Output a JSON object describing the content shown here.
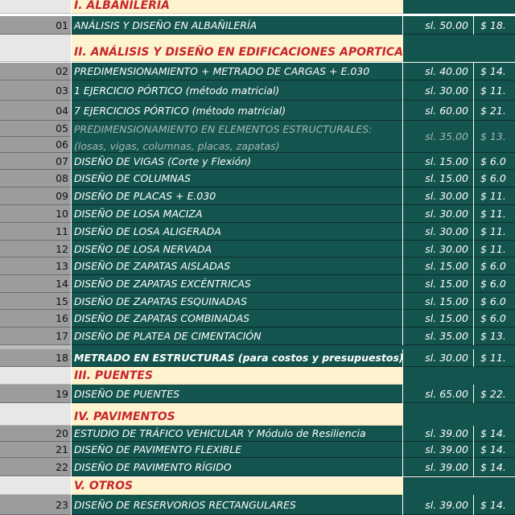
{
  "sections": {
    "s1": "I. ALBAÑILERIA",
    "s2": "II. ANÁLISIS Y DISEÑO EN EDIFICACIONES APORTICADAS",
    "s3": "III. PUENTES",
    "s4": "IV. PAVIMENTOS",
    "s5": "V. OTROS"
  },
  "rows": [
    {
      "num": "01",
      "desc": "ANÁLISIS Y DISEÑO EN ALBAÑILERÍA",
      "price_sl": "sl. 50.00",
      "price_usd": "$ 18."
    },
    {
      "num": "02",
      "desc": "PREDIMENSIONAMIENTO + METRADO DE CARGAS + E.030",
      "price_sl": "sl. 40.00",
      "price_usd": "$ 14."
    },
    {
      "num": "03",
      "desc": "1 EJERCICIO PÓRTICO (método matricial)",
      "price_sl": "sl. 30.00",
      "price_usd": "$ 11."
    },
    {
      "num": "04",
      "desc": "7 EJERCICIOS PÓRTICO (método matricial)",
      "price_sl": "sl. 60.00",
      "price_usd": "$ 21."
    },
    {
      "num": "05",
      "num_b": "06",
      "desc": "PREDIMENSIONAMIENTO EN ELEMENTOS ESTRUCTURALES:",
      "desc_b": "(losas, vigas, columnas, placas, zapatas)",
      "price_sl": "sl. 35.00",
      "price_usd": "$ 13."
    },
    {
      "num": "07",
      "desc": "DISEÑO DE VIGAS (Corte y Flexión)",
      "price_sl": "sl. 15.00",
      "price_usd": "$ 6.0"
    },
    {
      "num": "08",
      "desc": "DISEÑO DE COLUMNAS",
      "price_sl": "sl. 15.00",
      "price_usd": "$ 6.0"
    },
    {
      "num": "09",
      "desc": "DISEÑO DE PLACAS + E.030",
      "price_sl": "sl. 30.00",
      "price_usd": "$ 11."
    },
    {
      "num": "10",
      "desc": "DISEÑO DE LOSA MACIZA",
      "price_sl": "sl. 30.00",
      "price_usd": "$ 11."
    },
    {
      "num": "11",
      "desc": "DISEÑO DE LOSA ALIGERADA",
      "price_sl": "sl. 30.00",
      "price_usd": "$ 11."
    },
    {
      "num": "12",
      "desc": "DISEÑO DE LOSA NERVADA",
      "price_sl": "sl. 30.00",
      "price_usd": "$ 11."
    },
    {
      "num": "13",
      "desc": "DISEÑO DE ZAPATAS AISLADAS",
      "price_sl": "sl. 15.00",
      "price_usd": "$ 6.0"
    },
    {
      "num": "14",
      "desc": "DISEÑO DE ZAPATAS EXCÉNTRICAS",
      "price_sl": "sl. 15.00",
      "price_usd": "$ 6.0"
    },
    {
      "num": "15",
      "desc": "DISEÑO DE ZAPATAS ESQUINADAS",
      "price_sl": "sl. 15.00",
      "price_usd": "$ 6.0"
    },
    {
      "num": "16",
      "desc": "DISEÑO DE ZAPATAS COMBINADAS",
      "price_sl": "sl. 15.00",
      "price_usd": "$ 6.0"
    },
    {
      "num": "17",
      "desc": "DISEÑO DE PLATEA DE CIMENTACIÓN",
      "price_sl": "sl. 35.00",
      "price_usd": "$ 13."
    },
    {
      "num": "18",
      "desc": "METRADO EN ESTRUCTURAS (para costos y presupuestos)",
      "price_sl": "sl. 30.00",
      "price_usd": "$ 11."
    },
    {
      "num": "19",
      "desc": "DISEÑO DE PUENTES",
      "price_sl": "sl. 65.00",
      "price_usd": "$ 22."
    },
    {
      "num": "20",
      "desc": "ESTUDIO DE TRÁFICO VEHICULAR Y Módulo de Resiliencia",
      "price_sl": "sl. 39.00",
      "price_usd": "$ 14."
    },
    {
      "num": "21",
      "desc": "DISEÑO DE PAVIMENTO FLEXIBLE",
      "price_sl": "sl. 39.00",
      "price_usd": "$ 14."
    },
    {
      "num": "22",
      "desc": "DISEÑO DE PAVIMENTO RÍGIDO",
      "price_sl": "sl. 39.00",
      "price_usd": "$ 14."
    },
    {
      "num": "23",
      "desc": "DISEÑO DE RESERVORIOS RECTANGULARES",
      "price_sl": "sl. 39.00",
      "price_usd": "$ 14."
    }
  ],
  "colors": {
    "row_bg": "#14544e",
    "header_bg": "#fdf3cf",
    "header_text": "#c7262a",
    "number_col_bg": "#9c9c9c"
  }
}
